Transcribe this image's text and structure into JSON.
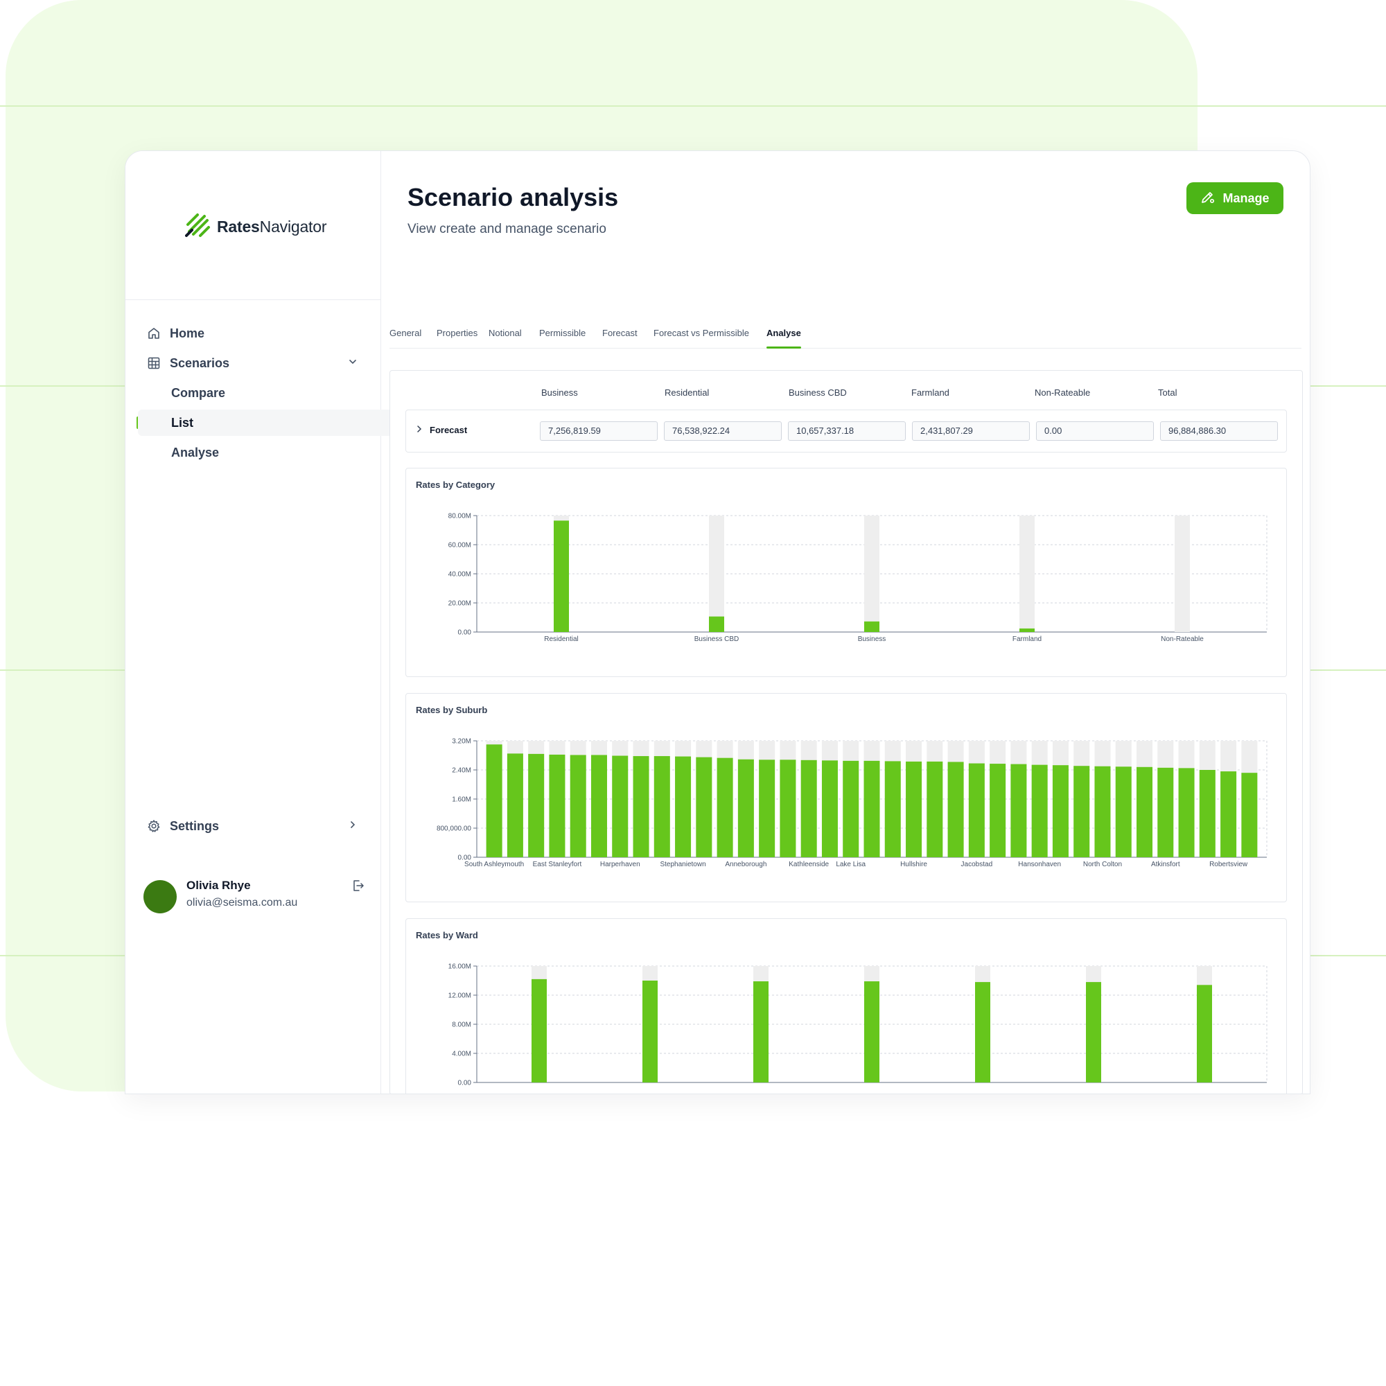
{
  "app": {
    "logo_bold": "Rates",
    "logo_regular": "Navigator"
  },
  "sidebar": {
    "items": [
      {
        "label": "Home",
        "icon": "home-icon"
      },
      {
        "label": "Scenarios",
        "icon": "table-icon",
        "expanded": true
      },
      {
        "label": "Compare"
      },
      {
        "label": "List",
        "active": true
      },
      {
        "label": "Analyse"
      },
      {
        "label": "Settings",
        "icon": "gear-icon"
      }
    ]
  },
  "user": {
    "name": "Olivia Rhye",
    "email": "olivia@seisma.com.au"
  },
  "header": {
    "title": "Scenario analysis",
    "subtitle": "View create and manage scenario",
    "manage_label": "Manage"
  },
  "tabs": [
    "General",
    "Properties",
    "Notional",
    "Permissible",
    "Forecast",
    "Forecast vs Permissible",
    "Analyse"
  ],
  "active_tab": "Analyse",
  "summary": {
    "columns": [
      "Business",
      "Residential",
      "Business CBD",
      "Farmland",
      "Non-Rateable",
      "Total"
    ],
    "row_label": "Forecast",
    "values": [
      "7,256,819.59",
      "76,538,922.24",
      "10,657,337.18",
      "2,431,807.29",
      "0.00",
      "96,884,886.30"
    ]
  },
  "colors": {
    "accent": "#4cb517",
    "bar": "#66c61c",
    "bar_background": "#eeeeee"
  },
  "chart_data": [
    {
      "type": "bar",
      "title": "Rates by Category",
      "categories": [
        "Residential",
        "Business CBD",
        "Business",
        "Farmland",
        "Non-Rateable"
      ],
      "values": [
        76538922.24,
        10657337.18,
        7256819.59,
        2431807.29,
        0
      ],
      "ylim": [
        0,
        80000000
      ],
      "yticks": [
        "0.00",
        "20.00M",
        "40.00M",
        "60.00M",
        "80.00M"
      ],
      "grid": true
    },
    {
      "type": "bar",
      "title": "Rates by Suburb",
      "categories": [
        "South Ashleymouth",
        "",
        "",
        "East Stanleyfort",
        "",
        "",
        "Harperhaven",
        "",
        "",
        "Stephanietown",
        "",
        "",
        "Anneborough",
        "",
        "",
        "Kathleenside",
        "",
        "Lake Lisa",
        "",
        "",
        "Hullshire",
        "",
        "",
        "Jacobstad",
        "",
        "",
        "Hansonhaven",
        "",
        "",
        "North Colton",
        "",
        "",
        "Atkinsfort",
        "",
        "",
        "Robertsview"
      ],
      "values": [
        3100000,
        2850000,
        2840000,
        2820000,
        2810000,
        2810000,
        2790000,
        2780000,
        2780000,
        2770000,
        2750000,
        2730000,
        2690000,
        2680000,
        2680000,
        2670000,
        2660000,
        2650000,
        2650000,
        2640000,
        2630000,
        2630000,
        2620000,
        2580000,
        2570000,
        2560000,
        2540000,
        2530000,
        2510000,
        2500000,
        2490000,
        2480000,
        2460000,
        2450000,
        2400000,
        2360000,
        2320000
      ],
      "ylim": [
        0,
        3200000
      ],
      "yticks": [
        "0.00",
        "800,000.00",
        "1.60M",
        "2.40M",
        "3.20M"
      ],
      "grid": true
    },
    {
      "type": "bar",
      "title": "Rates by Ward",
      "categories": [
        "",
        "",
        "",
        "",
        "",
        "",
        ""
      ],
      "values": [
        14200000,
        14000000,
        13900000,
        13900000,
        13800000,
        13800000,
        13400000
      ],
      "ylim": [
        0,
        16000000
      ],
      "yticks": [
        "0.00",
        "4.00M",
        "8.00M",
        "12.00M",
        "16.00M"
      ],
      "grid": true
    }
  ]
}
